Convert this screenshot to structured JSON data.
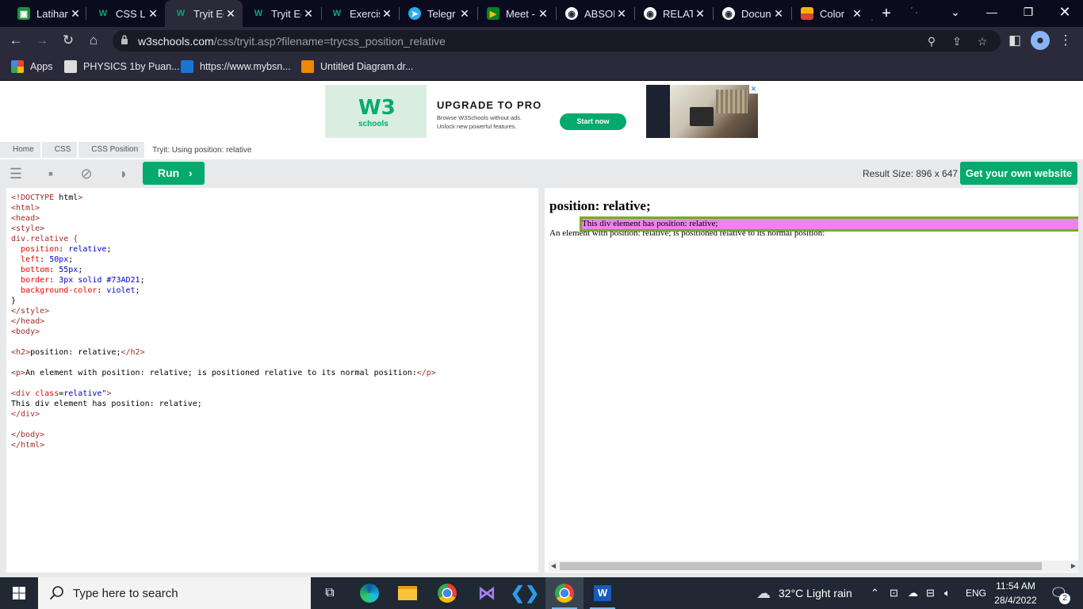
{
  "browser": {
    "tabs": [
      {
        "title": "Latihan",
        "icon": "classroom-icon",
        "color": "#1e8e3e"
      },
      {
        "title": "CSS La",
        "icon": "w3schools-icon",
        "color": "#04aa6d"
      },
      {
        "title": "Tryit Ed",
        "icon": "w3schools-icon",
        "color": "#04aa6d",
        "active": true
      },
      {
        "title": "Tryit Ed",
        "icon": "w3schools-icon",
        "color": "#04aa6d"
      },
      {
        "title": "Exercis",
        "icon": "w3schools-icon",
        "color": "#04aa6d"
      },
      {
        "title": "Telegr",
        "icon": "telegram-icon",
        "color": "#2aabee"
      },
      {
        "title": "Meet -",
        "icon": "google-meet-icon",
        "color": "#00832d"
      },
      {
        "title": "ABSOL",
        "icon": "globe-icon",
        "color": "#ffffff"
      },
      {
        "title": "RELATI",
        "icon": "globe-icon",
        "color": "#ffffff"
      },
      {
        "title": "Docun",
        "icon": "globe-icon",
        "color": "#ffffff"
      },
      {
        "title": "Color",
        "icon": "color-palette-icon",
        "color": "#f4b400"
      }
    ],
    "url_domain": "w3schools.com",
    "url_path": "/css/tryit.asp?filename=trycss_position_relative",
    "bookmarks": [
      {
        "label": "Apps",
        "icon": "apps-grid-icon"
      },
      {
        "label": "PHYSICS 1by Puan...",
        "icon": "classroom-icon"
      },
      {
        "label": "https://www.mybsn...",
        "icon": "bsn-icon"
      },
      {
        "label": "Untitled Diagram.dr...",
        "icon": "drawio-icon"
      }
    ]
  },
  "ad": {
    "logo_text": "W3",
    "logo_sub": "schools",
    "headline": "UPGRADE TO PRO",
    "line1": "Browse W3Schools without ads.",
    "line2": "Unlock new powerful features.",
    "cta": "Start now"
  },
  "breadcrumb": {
    "items": [
      "Home",
      "CSS",
      "CSS Position"
    ],
    "current": "Tryit: Using position: relative"
  },
  "toolbar": {
    "run_label": "Run",
    "result_size": "Result Size: 896 x 647",
    "get_own_label": "Get your own website"
  },
  "code_lines": [
    "<!DOCTYPE html>",
    "<html>",
    "<head>",
    "<style>",
    "div.relative {",
    "  position: relative;",
    "  left: 50px;",
    "  bottom: 55px;",
    "  border: 3px solid #73AD21;",
    "  background-color: violet;",
    "}",
    "</style>",
    "</head>",
    "<body>",
    "",
    "<h2>position: relative;</h2>",
    "",
    "<p>An element with position: relative; is positioned relative to its normal position:</p>",
    "",
    "<div class=\"relative\">",
    "This div element has position: relative;",
    "</div>",
    "",
    "</body>",
    "</html>"
  ],
  "result": {
    "heading": "position: relative;",
    "paragraph": "An element with position: relative; is positioned relative to its normal position:",
    "div_text": "This div element has position: relative;"
  },
  "taskbar": {
    "search_placeholder": "Type here to search",
    "weather": "32°C  Light rain",
    "language": "ENG",
    "time": "11:54 AM",
    "date": "28/4/2022",
    "notification_count": "2"
  },
  "colors": {
    "accent": "#04aa6d",
    "div_border": "#73AD21",
    "div_background": "violet"
  }
}
